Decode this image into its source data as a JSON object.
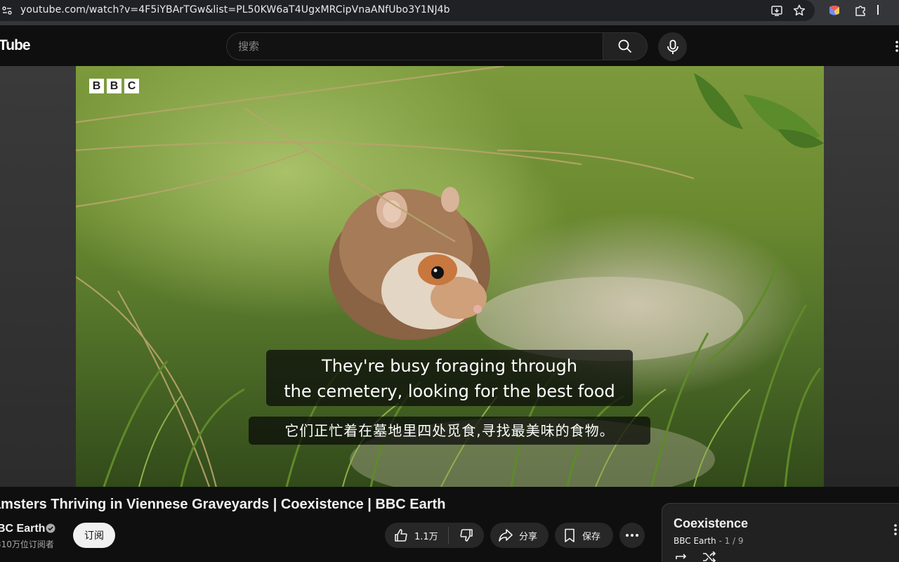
{
  "browser": {
    "url": "youtube.com/watch?v=4F5iYBArTGw&list=PL50KW6aT4UgxMRCipVnaANfUbo3Y1NJ4b"
  },
  "header": {
    "logo_text": "Tube",
    "search_placeholder": "搜索"
  },
  "video": {
    "channel_logo_letters": [
      "B",
      "B",
      "C"
    ],
    "caption_en_line1": "They're busy foraging through",
    "caption_en_line2": "the cemetery, looking for the best food",
    "caption_zh": "它们正忙着在墓地里四处觅食,寻找最美味的食物。"
  },
  "details": {
    "title": "amsters Thriving in Viennese Graveyards | Coexistence | BBC Earth",
    "channel_name": "BC Earth",
    "subscriber_count": "310万位订阅者",
    "subscribe_label": "订阅",
    "like_count": "1.1万",
    "share_label": "分享",
    "save_label": "保存"
  },
  "playlist": {
    "title": "Coexistence",
    "owner": "BBC Earth",
    "position": " - 1 / 9"
  },
  "colors": {
    "background": "#0f0f0f",
    "pill": "#272727",
    "subscribe_bg": "#f1f1f1",
    "secondary_text": "#aaaaaa"
  }
}
